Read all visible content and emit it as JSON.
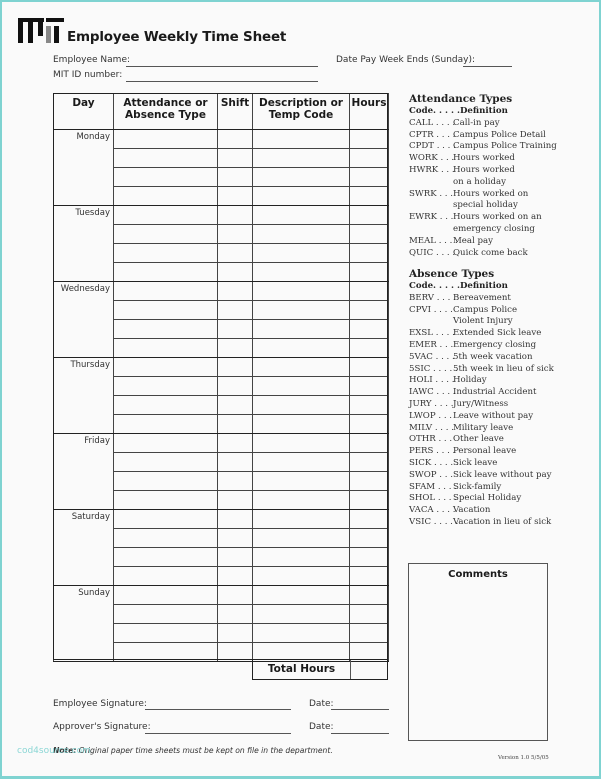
{
  "header": {
    "logo": "MIT",
    "title": "Employee Weekly Time Sheet",
    "employee_name_label": "Employee Name:",
    "mit_id_label": "MIT ID number:",
    "date_pay_week_label": "Date Pay Week Ends (Sunday):"
  },
  "table": {
    "columns": [
      "Day",
      "Attendance or Absence Type",
      "Shift",
      "Description or Temp Code",
      "Hours"
    ],
    "col_day": "Day",
    "col_type_1": "Attendance or",
    "col_type_2": "Absence Type",
    "col_shift": "Shift",
    "col_desc_1": "Description or",
    "col_desc_2": "Temp Code",
    "col_hours": "Hours",
    "days": [
      "Monday",
      "Tuesday",
      "Wednesday",
      "Thursday",
      "Friday",
      "Saturday",
      "Sunday"
    ],
    "rows_per_day": 4,
    "total_label": "Total Hours"
  },
  "attendance_types": {
    "title": "Attendance  Types",
    "code_header": "Code. . . . .",
    "def_header": "Definition",
    "items": [
      {
        "code": "CALL",
        "dots": " . . . .",
        "definition": "Call-in pay"
      },
      {
        "code": "CPTR",
        "dots": " . . . .",
        "definition": "Campus Police Detail"
      },
      {
        "code": "CPDT",
        "dots": " . . . .",
        "definition": "Campus Police Training"
      },
      {
        "code": "WORK",
        "dots": " . . .",
        "definition": "Hours worked"
      },
      {
        "code": "HWRK",
        "dots": " . . .",
        "definition": "Hours worked",
        "cont": "on a holiday"
      },
      {
        "code": "SWRK",
        "dots": " . . .",
        "definition": "Hours worked on",
        "cont": "special holiday"
      },
      {
        "code": "EWRK",
        "dots": " . . .",
        "definition": "Hours worked on an",
        "cont": "emergency closing"
      },
      {
        "code": "MEAL",
        "dots": " . . . .",
        "definition": "Meal pay"
      },
      {
        "code": "QUIC",
        "dots": " . . . .",
        "definition": "Quick come back"
      }
    ]
  },
  "absence_types": {
    "title": "Absence  Types",
    "code_header": "Code. . . . .",
    "def_header": "Definition",
    "items": [
      {
        "code": "BERV",
        "dots": " . . . .",
        "definition": "Bereavement"
      },
      {
        "code": "CPVI",
        "dots": " . . . .",
        "definition": "Campus Police",
        "cont": "Violent Injury"
      },
      {
        "code": "EXSL",
        "dots": " . . . .",
        "definition": "Extended Sick leave"
      },
      {
        "code": "EMER",
        "dots": " . . .",
        "definition": "Emergency closing"
      },
      {
        "code": "5VAC",
        "dots": " . . . .",
        "definition": "5th week vacation"
      },
      {
        "code": "5SIC",
        "dots": " . . . . .",
        "definition": "5th week in lieu of sick"
      },
      {
        "code": "HOLI",
        "dots": " . . . .",
        "definition": "Holiday"
      },
      {
        "code": "IAWC",
        "dots": " . . . .",
        "definition": "Industrial Accident"
      },
      {
        "code": "JURY",
        "dots": " . . . .",
        "definition": "Jury/Witness"
      },
      {
        "code": "LWOP",
        "dots": " . . .",
        "definition": "Leave without pay"
      },
      {
        "code": "MILV",
        "dots": " . . . .",
        "definition": "Military leave"
      },
      {
        "code": "OTHR",
        "dots": " . . .",
        "definition": "Other leave"
      },
      {
        "code": "PERS",
        "dots": " . . . .",
        "definition": "Personal leave"
      },
      {
        "code": "SICK",
        "dots": " . . . . .",
        "definition": "Sick leave"
      },
      {
        "code": "SWOP",
        "dots": " . . .",
        "definition": "Sick leave without pay"
      },
      {
        "code": "SFAM",
        "dots": " . . . .",
        "definition": "Sick-family"
      },
      {
        "code": "SHOL",
        "dots": " . . . .",
        "definition": "Special Holiday"
      },
      {
        "code": "VACA",
        "dots": " . . . .",
        "definition": "Vacation"
      },
      {
        "code": "VSIC",
        "dots": " . . . . .",
        "definition": "Vacation in lieu of sick"
      }
    ]
  },
  "comments": {
    "title": "Comments"
  },
  "signatures": {
    "employee_label": "Employee Signature:",
    "approver_label": "Approver's Signature:",
    "date_label": "Date:"
  },
  "footer": {
    "note_bold": "Note:",
    "note_text": " Original paper time sheets must be kept on file in the department.",
    "version": "Version 1.0 5/5/05",
    "watermark": "cod4source.com"
  },
  "colors": {
    "frame": "#7fd3d1",
    "watermark": "#7fd3d1"
  }
}
